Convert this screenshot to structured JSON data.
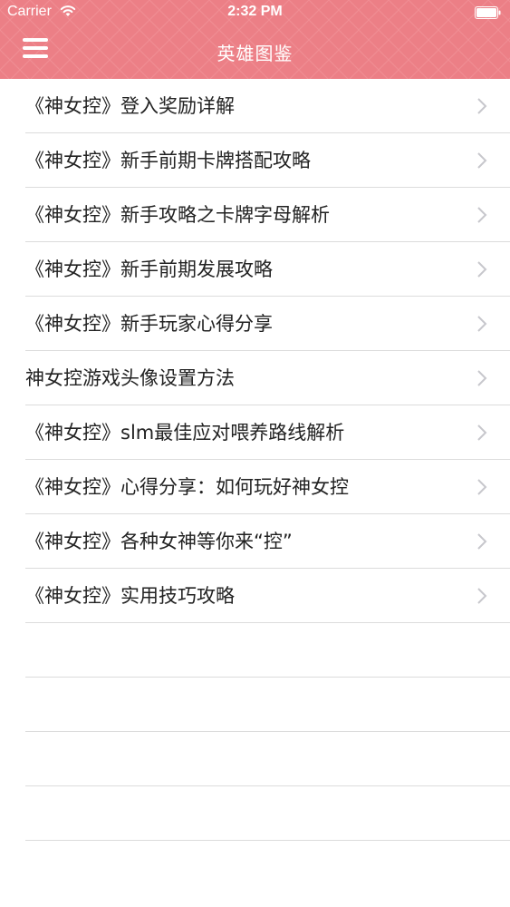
{
  "status_bar": {
    "carrier": "Carrier",
    "time": "2:32 PM",
    "wifi_icon": "wifi-icon",
    "battery_icon": "battery-icon"
  },
  "nav_bar": {
    "title": "英雄图鉴",
    "menu_icon": "hamburger-menu-icon",
    "background_color": "#ec7f86"
  },
  "list": {
    "items": [
      {
        "label": "《神女控》登入奖励详解"
      },
      {
        "label": "《神女控》新手前期卡牌搭配攻略"
      },
      {
        "label": "《神女控》新手攻略之卡牌字母解析"
      },
      {
        "label": "《神女控》新手前期发展攻略"
      },
      {
        "label": "《神女控》新手玩家心得分享"
      },
      {
        "label": "神女控游戏头像设置方法"
      },
      {
        "label": "《神女控》slm最佳应对喂养路线解析"
      },
      {
        "label": "《神女控》心得分享：如何玩好神女控"
      },
      {
        "label": "《神女控》各种女神等你来“控”"
      },
      {
        "label": "《神女控》实用技巧攻略"
      }
    ],
    "chevron_icon": "chevron-right-icon"
  }
}
